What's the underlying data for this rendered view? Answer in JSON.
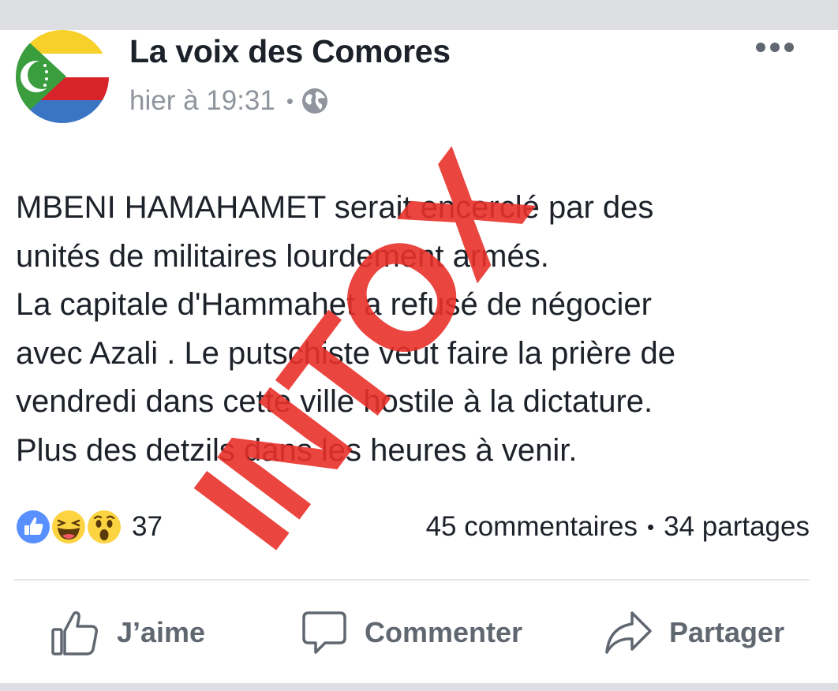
{
  "post": {
    "author": "La voix des Comores",
    "timestamp": "hier à 19:31",
    "separator": "•",
    "privacy_icon": "globe-icon",
    "more_icon": "more-horizontal-icon",
    "body_lines": [
      "MBENI HAMAHAMET serait encerclé par des",
      "unités de militaires lourdement armés.",
      "La capitale d'Hammahet a refusé de négocier",
      "avec Azali . Le putschiste veut faire la prière de",
      "vendredi dans cette ville hostile à la dictature.",
      "Plus des detzils dans les heures à venir."
    ],
    "overlay_stamp": "INTOX",
    "overlay_color": "#e8312a"
  },
  "reactions": {
    "icons": [
      "like-icon",
      "haha-icon",
      "wow-icon"
    ],
    "count": "37"
  },
  "stats": {
    "comments": "45 commentaires",
    "separator": "•",
    "shares": "34 partages"
  },
  "actions": {
    "like": "J’aime",
    "comment": "Commenter",
    "share": "Partager"
  },
  "colors": {
    "like_blue": "#5890ff",
    "reaction_yellow": "#fcd340",
    "meta_gray": "#90949c",
    "action_gray": "#606770"
  }
}
